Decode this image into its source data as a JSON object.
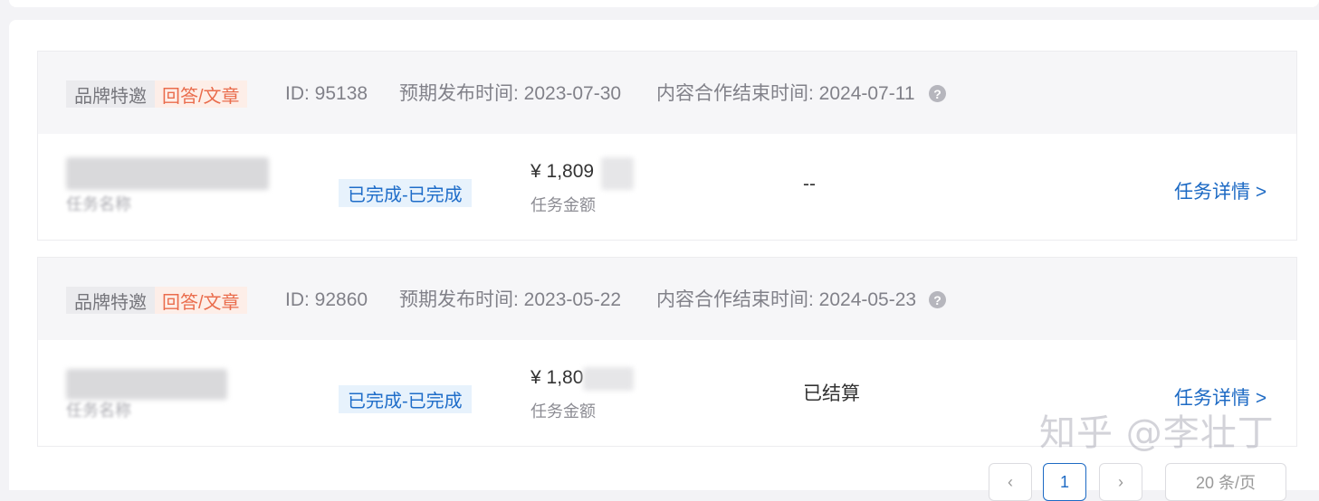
{
  "tasks": [
    {
      "tag_brand": "品牌特邀",
      "tag_type": "回答/文章",
      "id_text": "ID: 95138",
      "publish_time": "预期发布时间: 2023-07-30",
      "end_time": "内容合作结束时间: 2024-07-11",
      "name_label": "任务名称",
      "status": "已完成-已完成",
      "amount": "¥ 1,809",
      "amount_label": "任务金额",
      "settlement": "--",
      "detail_link": "任务详情 >"
    },
    {
      "tag_brand": "品牌特邀",
      "tag_type": "回答/文章",
      "id_text": "ID: 92860",
      "publish_time": "预期发布时间: 2023-05-22",
      "end_time": "内容合作结束时间: 2024-05-23",
      "name_label": "任务名称",
      "status": "已完成-已完成",
      "amount": "¥ 1,80",
      "amount_label": "任务金额",
      "settlement": "已结算",
      "detail_link": "任务详情 >"
    }
  ],
  "help_icon": "?",
  "pagination": {
    "prev": "‹",
    "current_page": "1",
    "next": "›",
    "page_size": "20 条/页"
  },
  "watermark": "知乎 @李壮丁",
  "colors": {
    "accent_blue": "#1d6ac4",
    "tag_orange": "#ea6c4c",
    "status_bg": "#e7f2fc"
  }
}
